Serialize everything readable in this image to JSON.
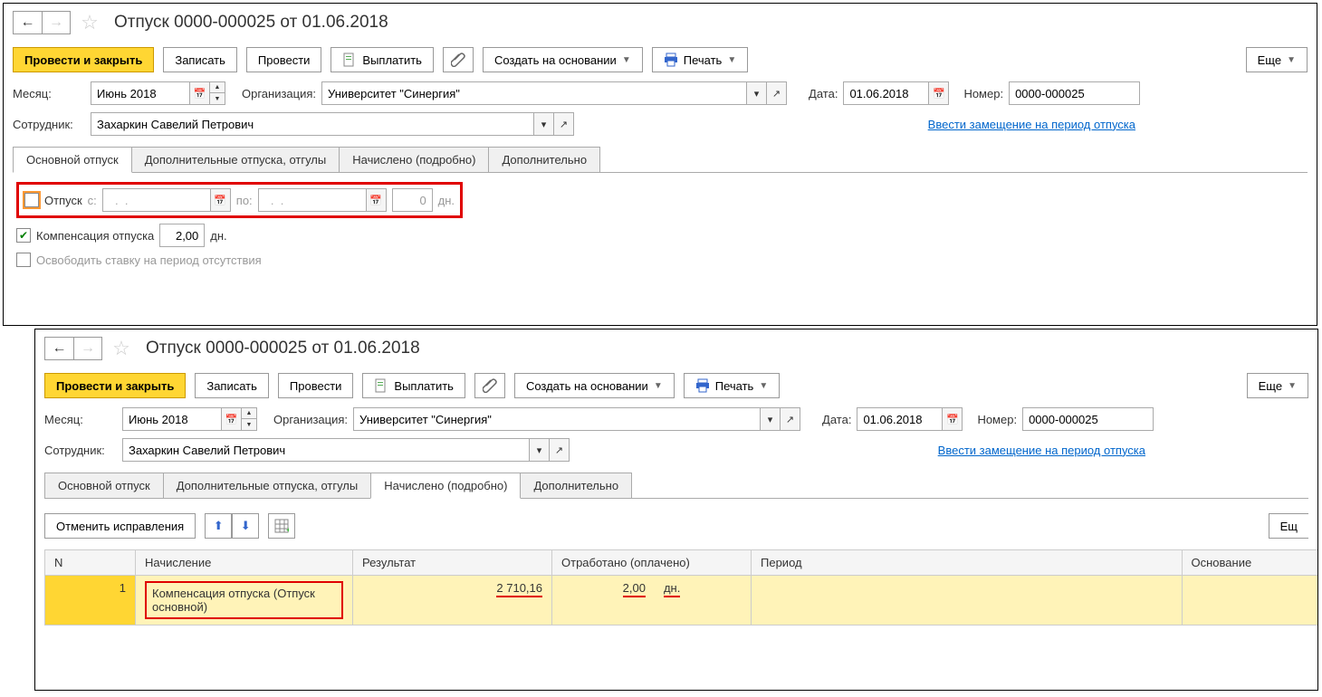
{
  "title": "Отпуск 0000-000025 от 01.06.2018",
  "toolbar": {
    "post_close": "Провести и закрыть",
    "write": "Записать",
    "post": "Провести",
    "pay": "Выплатить",
    "create_based": "Создать на основании",
    "print": "Печать",
    "more": "Еще"
  },
  "fields": {
    "month_label": "Месяц:",
    "month_value": "Июнь 2018",
    "org_label": "Организация:",
    "org_value": "Университет \"Синергия\"",
    "date_label": "Дата:",
    "date_value": "01.06.2018",
    "number_label": "Номер:",
    "number_value": "0000-000025",
    "employee_label": "Сотрудник:",
    "employee_value": "Захаркин Савелий Петрович",
    "substitute_link": "Ввести замещение на период отпуска"
  },
  "tabs": {
    "main": "Основной отпуск",
    "additional": "Дополнительные отпуска, отгулы",
    "accrued": "Начислено (подробно)",
    "extra": "Дополнительно"
  },
  "main_tab": {
    "vacation_label": "Отпуск",
    "from_label": "с:",
    "from_placeholder": "  .  .    ",
    "to_label": "по:",
    "to_placeholder": "  .  .    ",
    "days_value": "0",
    "days_unit": "дн.",
    "compensation_label": "Компенсация отпуска",
    "compensation_value": "2,00",
    "compensation_unit": "дн.",
    "release_label": "Освободить ставку на период отсутствия"
  },
  "accrued_tab": {
    "cancel_btn": "Отменить исправления",
    "more_btn": "Ещ",
    "columns": {
      "n": "N",
      "accrual": "Начисление",
      "result": "Результат",
      "worked": "Отработано (оплачено)",
      "period": "Период",
      "basis": "Основание"
    },
    "row": {
      "n": "1",
      "accrual": "Компенсация отпуска (Отпуск основной)",
      "result": "2 710,16",
      "worked_val": "2,00",
      "worked_unit": "дн."
    }
  }
}
